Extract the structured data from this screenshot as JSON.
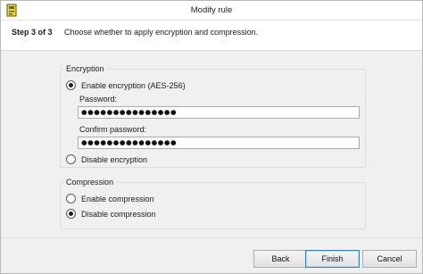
{
  "window": {
    "title": "Modify rule",
    "icon": "app-icon"
  },
  "header": {
    "step_label": "Step 3 of 3",
    "description": "Choose whether to apply encryption and compression."
  },
  "encryption": {
    "group_title": "Encryption",
    "enable_label": "Enable encryption (AES-256)",
    "enable_selected": true,
    "password_label": "Password:",
    "password_value": "●●●●●●●●●●●●●●●",
    "confirm_label": "Confirm password:",
    "confirm_value": "●●●●●●●●●●●●●●●",
    "disable_label": "Disable encryption",
    "disable_selected": false
  },
  "compression": {
    "group_title": "Compression",
    "enable_label": "Enable compression",
    "enable_selected": false,
    "disable_label": "Disable compression",
    "disable_selected": true
  },
  "footer": {
    "back_label": "Back",
    "finish_label": "Finish",
    "cancel_label": "Cancel"
  },
  "colors": {
    "window_bg": "#f0f0f0",
    "header_bg": "#ffffff",
    "group_border": "#d5dfe5",
    "default_button_border": "#3c7fb1"
  }
}
